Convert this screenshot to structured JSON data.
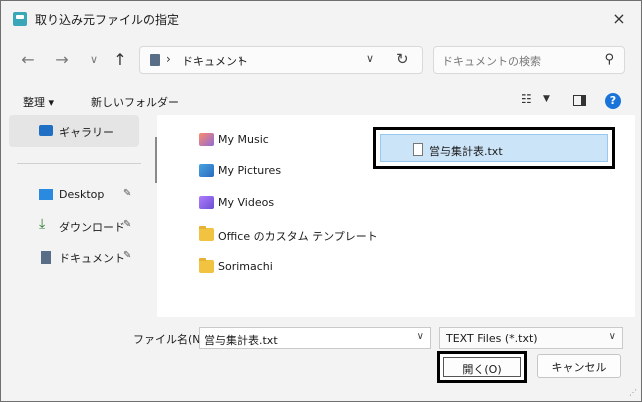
{
  "window": {
    "title": "取り込み元ファイルの指定",
    "close_icon": "×"
  },
  "nav": {
    "back": "←",
    "forward": "→",
    "recent": "∨",
    "up": "↑",
    "address": {
      "crumb": "ドキュメント",
      "sep": "›"
    },
    "refresh": "↻",
    "search_placeholder": "ドキュメントの検索"
  },
  "toolbar": {
    "organize": "整理 ▾",
    "new_folder": "新しいフォルダー",
    "help": "?"
  },
  "sidebar": {
    "gallery": "ギャラリー",
    "items": [
      {
        "label": "Desktop",
        "icon": "desktop-icon",
        "color": "#2a8ae0"
      },
      {
        "label": "ダウンロード",
        "icon": "download-icon",
        "color": "#2e7d32"
      },
      {
        "label": "ドキュメント",
        "icon": "document-icon",
        "color": "#5a6d86"
      }
    ],
    "pin": "📌"
  },
  "files": [
    {
      "label": "My Music",
      "icon": "music-folder-icon"
    },
    {
      "label": "My Pictures",
      "icon": "pictures-folder-icon"
    },
    {
      "label": "My Videos",
      "icon": "videos-folder-icon"
    },
    {
      "label": "Office のカスタム テンプレート",
      "icon": "folder-icon"
    },
    {
      "label": "Sorimachi",
      "icon": "folder-icon"
    }
  ],
  "selected_file": "営与集計表.txt",
  "bottom": {
    "filename_label": "ファイル名(N):",
    "filename_value": "営与集計表.txt",
    "filetype_value": "TEXT Files (*.txt)",
    "open_label": "開く(O)",
    "cancel_label": "キャンセル"
  },
  "colors": {
    "selection": "#cce4f7",
    "help": "#1a73d9"
  }
}
